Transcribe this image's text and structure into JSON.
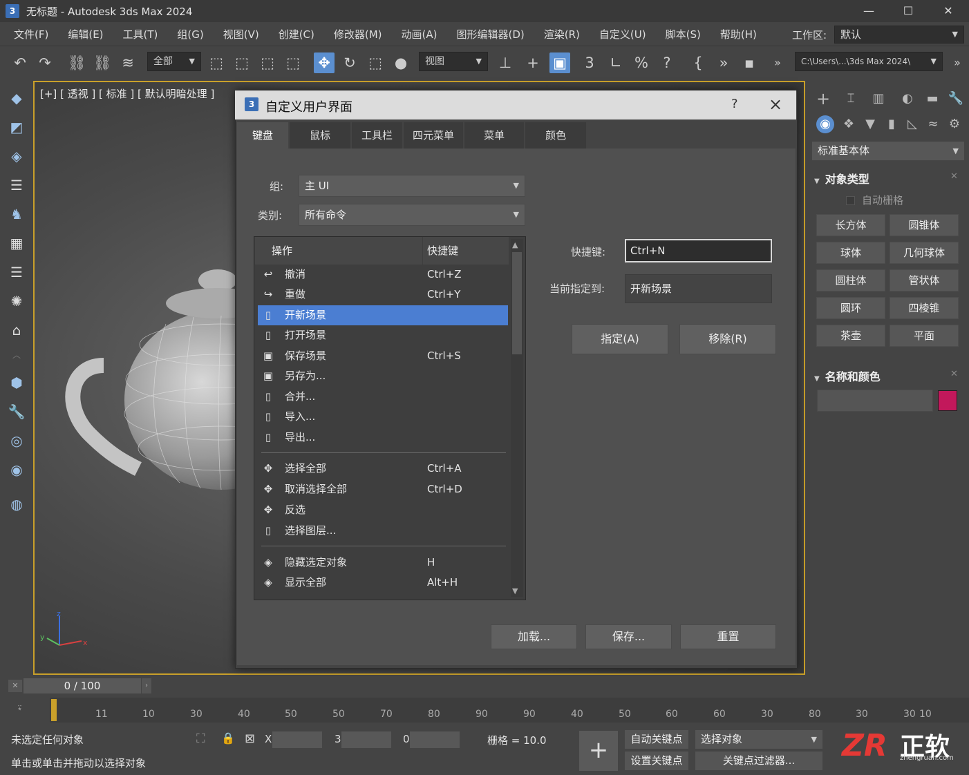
{
  "window": {
    "title": "无标题 - Autodesk 3ds Max 2024",
    "logo": "3"
  },
  "menu": [
    "文件(F)",
    "编辑(E)",
    "工具(T)",
    "组(G)",
    "视图(V)",
    "创建(C)",
    "修改器(M)",
    "动画(A)",
    "图形编辑器(D)",
    "渲染(R)",
    "自定义(U)",
    "脚本(S)",
    "帮助(H)"
  ],
  "workspace": {
    "label": "工作区:",
    "value": "默认"
  },
  "toolbar": {
    "filter_select": "全部",
    "view_select": "视图",
    "path_select": "C:\\Users\\...\\3ds Max 2024\\"
  },
  "viewport": {
    "label": "[+] [ 透视 ] [ 标准 ] [ 默认明暗处理 ]"
  },
  "right_panel": {
    "dropdown": "标准基本体",
    "section_object_type": "对象类型",
    "autogrid": "自动栅格",
    "buttons": [
      "长方体",
      "圆锥体",
      "球体",
      "几何球体",
      "圆柱体",
      "管状体",
      "圆环",
      "四棱锥",
      "茶壶",
      "平面"
    ],
    "section_name_color": "名称和颜色",
    "color": "#c2185b"
  },
  "dialog": {
    "title": "自定义用户界面",
    "icon": "3",
    "help": "?",
    "tabs": [
      "键盘",
      "鼠标",
      "工具栏",
      "四元菜单",
      "菜单",
      "颜色"
    ],
    "group_label": "组:",
    "group_value": "主 UI",
    "category_label": "类别:",
    "category_value": "所有命令",
    "col_action": "操作",
    "col_shortcut": "快捷键",
    "rows": [
      {
        "label": "撤消",
        "key": "Ctrl+Z",
        "icon": "undo-icon",
        "glyph": "↩"
      },
      {
        "label": "重做",
        "key": "Ctrl+Y",
        "icon": "redo-icon",
        "glyph": "↪"
      },
      {
        "label": "开新场景",
        "key": "",
        "icon": "new-file-icon",
        "glyph": "▯"
      },
      {
        "label": "打开场景",
        "key": "",
        "icon": "file-icon",
        "glyph": "▯"
      },
      {
        "label": "保存场景",
        "key": "Ctrl+S",
        "icon": "save-icon",
        "glyph": "▣"
      },
      {
        "label": "另存为...",
        "key": "",
        "icon": "save-as-icon",
        "glyph": "▣"
      },
      {
        "label": "合并...",
        "key": "",
        "icon": "merge-icon",
        "glyph": "▯"
      },
      {
        "label": "导入...",
        "key": "",
        "icon": "import-icon",
        "glyph": "▯"
      },
      {
        "label": "导出...",
        "key": "",
        "icon": "export-icon",
        "glyph": "▯"
      },
      {
        "label": "选择全部",
        "key": "Ctrl+A",
        "icon": "select-all-icon",
        "glyph": "✥"
      },
      {
        "label": "取消选择全部",
        "key": "Ctrl+D",
        "icon": "deselect-all-icon",
        "glyph": "✥"
      },
      {
        "label": "反选",
        "key": "",
        "icon": "invert-select-icon",
        "glyph": "✥"
      },
      {
        "label": "选择图层...",
        "key": "",
        "icon": "layer-icon",
        "glyph": "▯"
      },
      {
        "label": "隐藏选定对象",
        "key": "H",
        "icon": "hide-icon",
        "glyph": "◈"
      },
      {
        "label": "显示全部",
        "key": "Alt+H",
        "icon": "show-icon",
        "glyph": "◈"
      }
    ],
    "shortcut_label": "快捷键:",
    "shortcut_value": "Ctrl+N",
    "assigned_label": "当前指定到:",
    "assigned_value": "开新场景",
    "assign_button": "指定(A)",
    "remove_button": "移除(R)",
    "load_button": "加载...",
    "save_button": "保存...",
    "reset_button": "重置"
  },
  "timeline": {
    "frame": "0 / 100",
    "ticks": [
      "11",
      "10",
      "30",
      "40",
      "50",
      "50",
      "70",
      "80",
      "90",
      "90",
      "40",
      "50",
      "60",
      "60",
      "30",
      "80",
      "30",
      "30",
      "10"
    ]
  },
  "status": {
    "line1": "未选定任何对象",
    "line2": "单击或单击并拖动以选择对象",
    "x_label": "X",
    "y_label": "3",
    "z_label": "0",
    "grid": "栅格 = 10.0",
    "auto_key": "自动关键点",
    "select_obj": "选择对象",
    "set_key": "设置关键点",
    "key_filter": "关键点过滤器..."
  },
  "watermark": {
    "logo": "ZR",
    "name": "正软",
    "url": "zhengruan.com"
  }
}
